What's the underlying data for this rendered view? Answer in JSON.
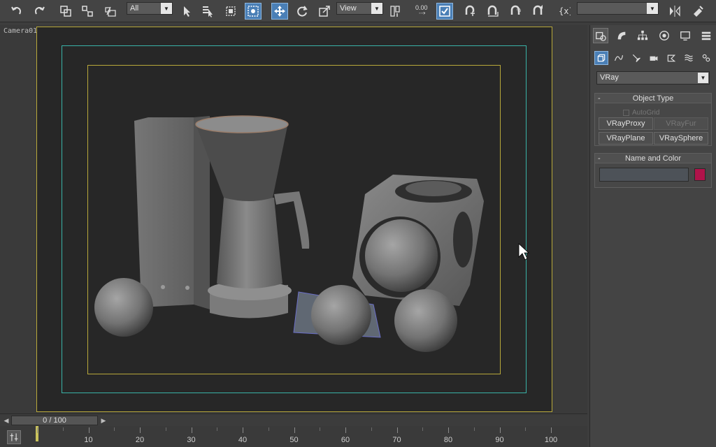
{
  "toolbar": {
    "selection_filter": "All",
    "reference_coord": "View",
    "snap_value": "0.00",
    "named_selection": ""
  },
  "viewport": {
    "label": "Camera01"
  },
  "command_panel": {
    "category": "VRay",
    "object_type": {
      "title": "Object Type",
      "autogrid_label": "AutoGrid",
      "buttons": [
        "VRayProxy",
        "VRayFur",
        "VRayPlane",
        "VRaySphere"
      ]
    },
    "name_and_color": {
      "title": "Name and Color",
      "name_value": "",
      "color": "#b0134a"
    }
  },
  "timeline": {
    "frame_display": "0 / 100",
    "ticks": [
      "10",
      "20",
      "30",
      "40",
      "50",
      "60",
      "70",
      "80",
      "90",
      "100"
    ]
  },
  "colors": {
    "active_tool": "#4a7fb6",
    "safe_frame_outer": "#39b3a8",
    "safe_frame_inner": "#b8a83a"
  }
}
